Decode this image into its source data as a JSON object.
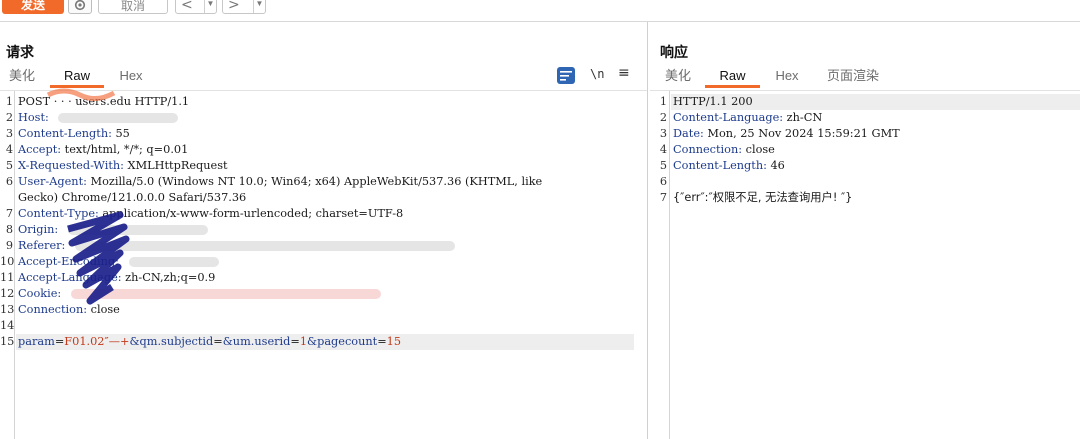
{
  "toolbar": {
    "send_label": "发送",
    "cancel_label": "取消",
    "back_icon": "chevron-left-icon",
    "forward_icon": "chevron-right-icon",
    "settings_icon": "gear-icon"
  },
  "request": {
    "title": "请求",
    "tabs": [
      "美化",
      "Raw",
      "Hex"
    ],
    "active_tab": "Raw",
    "tool_icons": [
      "wrap-icon",
      "newline-icon",
      "menu-icon"
    ],
    "newline_label": "\\n",
    "lines": [
      {
        "n": "1",
        "key": "",
        "text": "POST  ·  ·  ·  users.edu HTTP/1.1"
      },
      {
        "n": "2",
        "key": "Host:",
        "text": " "
      },
      {
        "n": "3",
        "key": "Content-Length:",
        "text": " 55"
      },
      {
        "n": "4",
        "key": "Accept:",
        "text": " text/html, */*; q=0.01"
      },
      {
        "n": "5",
        "key": "X-Requested-With:",
        "text": " XMLHttpRequest"
      },
      {
        "n": "6",
        "key": "User-Agent:",
        "text": " Mozilla/5.0 (Windows NT 10.0; Win64; x64) AppleWebKit/537.36 (KHTML, like"
      },
      {
        "n": "",
        "key": "",
        "text": "Gecko) Chrome/121.0.0.0 Safari/537.36"
      },
      {
        "n": "7",
        "key": "Content-Type:",
        "text": " application/x-www-form-urlencoded; charset=UTF-8"
      },
      {
        "n": "8",
        "key": "Origin:",
        "text": " "
      },
      {
        "n": "9",
        "key": "Referer:",
        "text": " "
      },
      {
        "n": "10",
        "key": "Accept-Encoding:",
        "text": " "
      },
      {
        "n": "11",
        "key": "Accept-Language:",
        "text": " zh-CN,zh;q=0.9"
      },
      {
        "n": "12",
        "key": "Cookie:",
        "text": " "
      },
      {
        "n": "13",
        "key": "Connection:",
        "text": " close"
      },
      {
        "n": "14",
        "key": "",
        "text": ""
      }
    ],
    "body_line": {
      "n": "15",
      "p1_key": "param",
      "p1_val": "F01.02″—+",
      "p2_key": "&qm.subjectid",
      "p2_val": "",
      "p3_key": "&um.userid",
      "p3_val": "1",
      "p4_key": "&pagecount",
      "p4_val": "15"
    }
  },
  "response": {
    "title": "响应",
    "tabs": [
      "美化",
      "Raw",
      "Hex",
      "页面渲染"
    ],
    "active_tab": "Raw",
    "lines": [
      {
        "n": "1",
        "key": "",
        "text": "HTTP/1.1 200"
      },
      {
        "n": "2",
        "key": "Content-Language:",
        "text": " zh-CN"
      },
      {
        "n": "3",
        "key": "Date:",
        "text": " Mon, 25 Nov 2024 15:59:21 GMT"
      },
      {
        "n": "4",
        "key": "Connection:",
        "text": " close"
      },
      {
        "n": "5",
        "key": "Content-Length:",
        "text": " 46"
      },
      {
        "n": "6",
        "key": "",
        "text": ""
      },
      {
        "n": "7",
        "key": "",
        "text": "{″err″:″权限不足, 无法查询用户! ″}"
      }
    ]
  },
  "colors": {
    "accent": "#f26a2a",
    "header_key": "#1e3b8c",
    "param_value": "#c23a1a",
    "wrap_button": "#2f66b3"
  }
}
